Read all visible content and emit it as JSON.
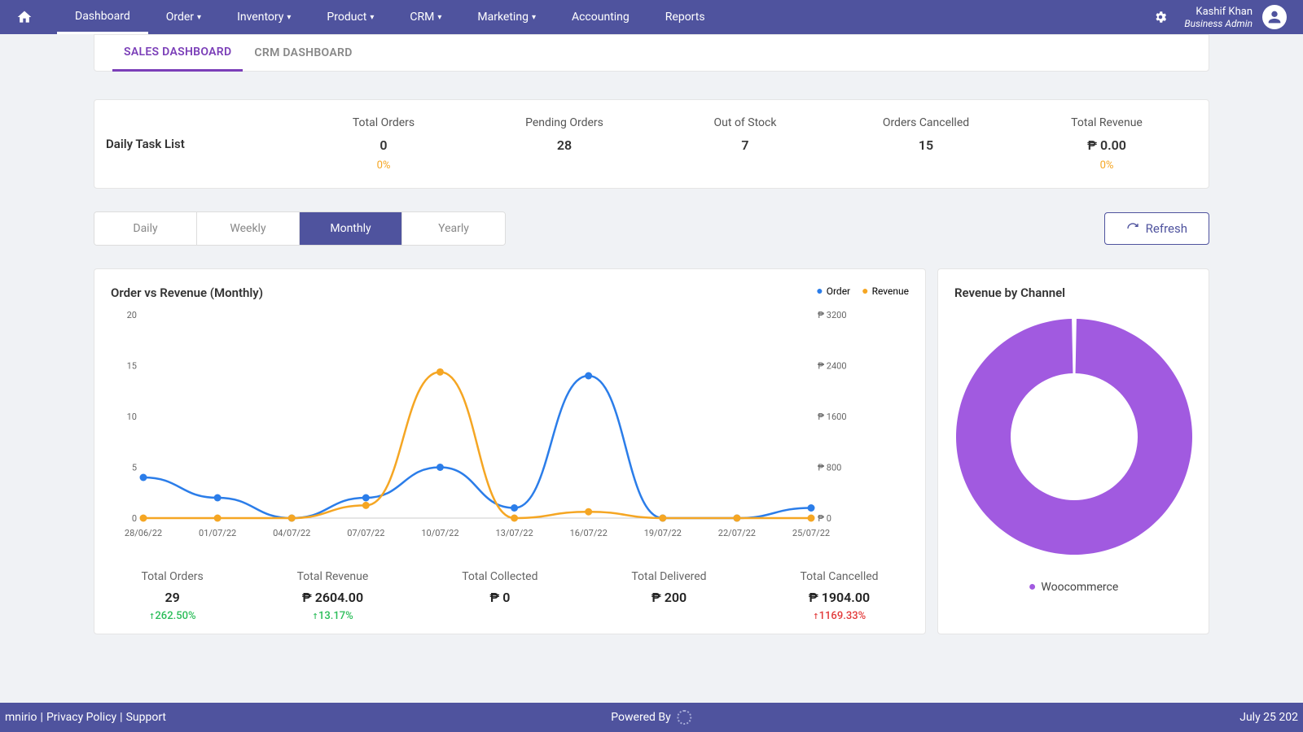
{
  "nav": {
    "items": [
      "Dashboard",
      "Order",
      "Inventory",
      "Product",
      "CRM",
      "Marketing",
      "Accounting",
      "Reports"
    ],
    "dropdown": [
      false,
      true,
      true,
      true,
      true,
      true,
      false,
      false
    ],
    "active": 0
  },
  "user": {
    "name": "Kashif Khan",
    "role": "Business Admin"
  },
  "tabs": {
    "items": [
      "SALES DASHBOARD",
      "CRM DASHBOARD"
    ],
    "active": 0
  },
  "daily_task": {
    "title": "Daily Task List",
    "stats": [
      {
        "label": "Total Orders",
        "value": "0",
        "pct": "0%"
      },
      {
        "label": "Pending Orders",
        "value": "28",
        "pct": ""
      },
      {
        "label": "Out of Stock",
        "value": "7",
        "pct": ""
      },
      {
        "label": "Orders Cancelled",
        "value": "15",
        "pct": ""
      },
      {
        "label": "Total Revenue",
        "value": "₱  0.00",
        "pct": "0%"
      }
    ]
  },
  "period": {
    "options": [
      "Daily",
      "Weekly",
      "Monthly",
      "Yearly"
    ],
    "active": 2
  },
  "refresh_label": "Refresh",
  "line_chart": {
    "title": "Order vs Revenue (Monthly)",
    "legend": [
      "Order",
      "Revenue"
    ]
  },
  "kpis": [
    {
      "label": "Total Orders",
      "value": "29",
      "change": "262.50%",
      "dir": "up"
    },
    {
      "label": "Total Revenue",
      "value": "₱  2604.00",
      "change": "13.17%",
      "dir": "up"
    },
    {
      "label": "Total Collected",
      "value": "₱  0",
      "change": "",
      "dir": ""
    },
    {
      "label": "Total Delivered",
      "value": "₱  200",
      "change": "",
      "dir": ""
    },
    {
      "label": "Total Cancelled",
      "value": "₱  1904.00",
      "change": "1169.33%",
      "dir": "down"
    }
  ],
  "donut": {
    "title": "Revenue by Channel",
    "legend": "Woocommerce"
  },
  "footer": {
    "left": "mnirio | Privacy Policy | Support",
    "mid": "Powered By",
    "date": "July 25 202"
  },
  "chart_data": [
    {
      "type": "line",
      "title": "Order vs Revenue (Monthly)",
      "categories": [
        "28/06/22",
        "01/07/22",
        "04/07/22",
        "07/07/22",
        "10/07/22",
        "13/07/22",
        "16/07/22",
        "19/07/22",
        "22/07/22",
        "25/07/22"
      ],
      "series": [
        {
          "name": "Order",
          "axis": "left",
          "values": [
            4,
            2,
            0,
            2,
            5,
            1,
            14,
            0,
            0,
            1
          ]
        },
        {
          "name": "Revenue",
          "axis": "right",
          "values": [
            0,
            0,
            0,
            200,
            2300,
            0,
            100,
            0,
            0,
            0
          ]
        }
      ],
      "y_left": {
        "label": "",
        "min": 0,
        "max": 20,
        "ticks": [
          0,
          5,
          10,
          15,
          20
        ]
      },
      "y_right": {
        "label": "₱",
        "min": 0,
        "max": 3200,
        "ticks": [
          0,
          800,
          1600,
          2400,
          3200
        ]
      },
      "colors": {
        "Order": "#2b7de9",
        "Revenue": "#f5a623"
      }
    },
    {
      "type": "pie",
      "title": "Revenue by Channel",
      "slices": [
        {
          "name": "Woocommerce",
          "value": 100,
          "color": "#a15ae0"
        }
      ]
    }
  ]
}
